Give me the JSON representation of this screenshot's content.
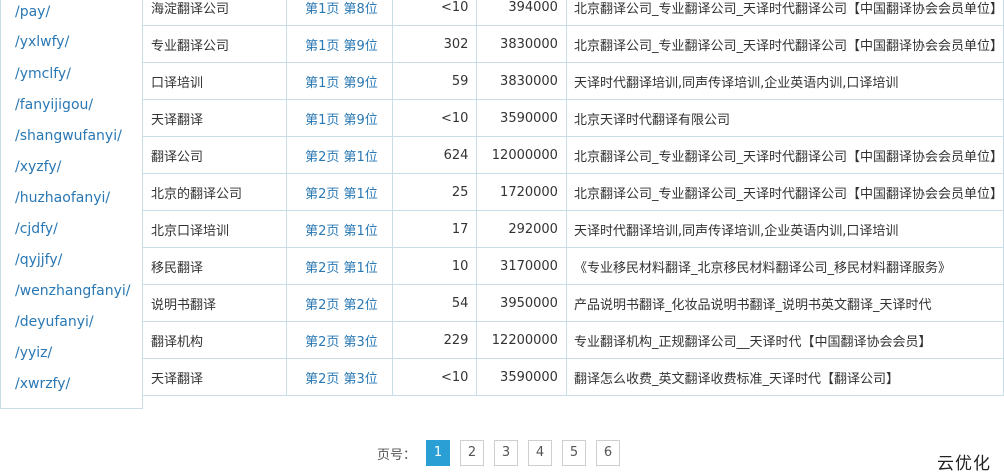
{
  "paths": [
    "/pay/",
    "/yxlwfy/",
    "/ymclfy/",
    "/fanyijigou/",
    "/shangwufanyi/",
    "/xyzfy/",
    "/huzhaofanyi/",
    "/cjdfy/",
    "/qyjjfy/",
    "/wenzhangfanyi/",
    "/deyufanyi/",
    "/yyiz/",
    "/xwrzfy/"
  ],
  "rows": [
    {
      "keyword": "海淀翻译公司",
      "rank": "第1页 第8位",
      "index": "<10",
      "count": "394000",
      "title": "北京翻译公司_专业翻译公司_天译时代翻译公司【中国翻译协会会员单位】"
    },
    {
      "keyword": "专业翻译公司",
      "rank": "第1页 第9位",
      "index": "302",
      "count": "3830000",
      "title": "北京翻译公司_专业翻译公司_天译时代翻译公司【中国翻译协会会员单位】"
    },
    {
      "keyword": "口译培训",
      "rank": "第1页 第9位",
      "index": "59",
      "count": "3830000",
      "title": "天译时代翻译培训,同声传译培训,企业英语内训,口译培训"
    },
    {
      "keyword": "天译翻译",
      "rank": "第1页 第9位",
      "index": "<10",
      "count": "3590000",
      "title": "北京天译时代翻译有限公司"
    },
    {
      "keyword": "翻译公司",
      "rank": "第2页 第1位",
      "index": "624",
      "count": "12000000",
      "title": "北京翻译公司_专业翻译公司_天译时代翻译公司【中国翻译协会会员单位】"
    },
    {
      "keyword": "北京的翻译公司",
      "rank": "第2页 第1位",
      "index": "25",
      "count": "1720000",
      "title": "北京翻译公司_专业翻译公司_天译时代翻译公司【中国翻译协会会员单位】"
    },
    {
      "keyword": "北京口译培训",
      "rank": "第2页 第1位",
      "index": "17",
      "count": "292000",
      "title": "天译时代翻译培训,同声传译培训,企业英语内训,口译培训"
    },
    {
      "keyword": "移民翻译",
      "rank": "第2页 第1位",
      "index": "10",
      "count": "3170000",
      "title": "《专业移民材料翻译_北京移民材料翻译公司_移民材料翻译服务》"
    },
    {
      "keyword": "说明书翻译",
      "rank": "第2页 第2位",
      "index": "54",
      "count": "3950000",
      "title": "产品说明书翻译_化妆品说明书翻译_说明书英文翻译_天译时代"
    },
    {
      "keyword": "翻译机构",
      "rank": "第2页 第3位",
      "index": "229",
      "count": "12200000",
      "title": "专业翻译机构_正规翻译公司__天译时代【中国翻译协会会员】"
    },
    {
      "keyword": "天译翻译",
      "rank": "第2页 第3位",
      "index": "<10",
      "count": "3590000",
      "title": "翻译怎么收费_英文翻译收费标准_天译时代【翻译公司】"
    }
  ],
  "pager": {
    "label": "页号：",
    "pages": [
      "1",
      "2",
      "3",
      "4",
      "5",
      "6"
    ],
    "current": "1"
  },
  "watermark": "云优化",
  "colors": {
    "accent": "#2a9fd6",
    "link": "#2a78b4",
    "border": "#c9dde8"
  }
}
